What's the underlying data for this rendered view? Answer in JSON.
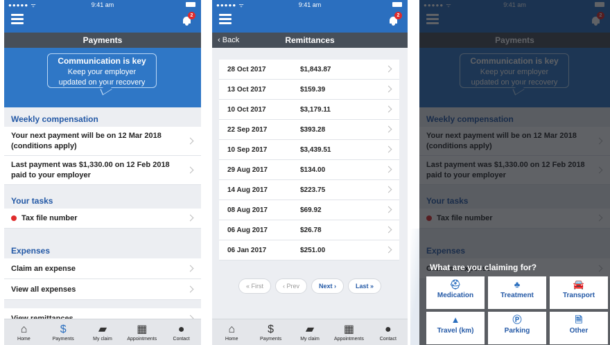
{
  "status": {
    "signal": "●●●●● ᯤ",
    "time": "9:41 am"
  },
  "notifications": {
    "count": "2"
  },
  "screen1": {
    "title": "Payments",
    "hero": {
      "heading": "Communication is key",
      "line1": "Keep your employer",
      "line2": "updated on your recovery"
    },
    "weekly": {
      "heading": "Weekly compensation",
      "next_payment": "Your next payment will be on 12 Mar 2018 (conditions apply)",
      "last_payment": "Last payment was $1,330.00 on 12 Feb 2018 paid to your employer"
    },
    "tasks": {
      "heading": "Your tasks",
      "item": "Tax file number"
    },
    "expenses": {
      "heading": "Expenses",
      "claim": "Claim an expense",
      "view": "View all expenses",
      "remittances": "View remittances"
    }
  },
  "screen2": {
    "back": "Back",
    "title": "Remittances",
    "rows": [
      {
        "date": "28 Oct 2017",
        "amount": "$1,843.87"
      },
      {
        "date": "13 Oct 2017",
        "amount": "$159.39"
      },
      {
        "date": "10 Oct 2017",
        "amount": "$3,179.11"
      },
      {
        "date": "22 Sep 2017",
        "amount": "$393.28"
      },
      {
        "date": "10 Sep 2017",
        "amount": "$3,439.51"
      },
      {
        "date": "29 Aug 2017",
        "amount": "$134.00"
      },
      {
        "date": "14 Aug 2017",
        "amount": "$223.75"
      },
      {
        "date": "08 Aug 2017",
        "amount": "$69.92"
      },
      {
        "date": "06 Aug 2017",
        "amount": "$26.78"
      },
      {
        "date": "06 Jan 2017",
        "amount": "$251.00"
      }
    ],
    "pager": {
      "first": "« First",
      "prev": "‹ Prev",
      "next": "Next ›",
      "last": "Last »"
    }
  },
  "screen3": {
    "sheet_title": "What are you claiming for?",
    "options": [
      {
        "label": "Medication",
        "icon": "medical-kit-icon",
        "glyph": "⛑"
      },
      {
        "label": "Treatment",
        "icon": "treatment-icon",
        "glyph": "♣"
      },
      {
        "label": "Transport",
        "icon": "car-icon",
        "glyph": "🚘"
      },
      {
        "label": "Travel (km)",
        "icon": "road-icon",
        "glyph": "▲"
      },
      {
        "label": "Parking",
        "icon": "parking-icon",
        "glyph": "Ⓟ"
      },
      {
        "label": "Other",
        "icon": "document-icon",
        "glyph": "🗎"
      }
    ]
  },
  "tabs": [
    {
      "label": "Home",
      "icon": "home-icon",
      "glyph": "⌂"
    },
    {
      "label": "Payments",
      "icon": "dollar-icon",
      "glyph": "$"
    },
    {
      "label": "My claim",
      "icon": "folder-icon",
      "glyph": "▰"
    },
    {
      "label": "Appointments",
      "icon": "calendar-icon",
      "glyph": "▦"
    },
    {
      "label": "Contact",
      "icon": "chat-icon",
      "glyph": "●"
    }
  ],
  "colors": {
    "primary": "#2b6fbf",
    "title_bar": "#474f59",
    "heading": "#2459a6",
    "alert": "#e02b2b"
  }
}
